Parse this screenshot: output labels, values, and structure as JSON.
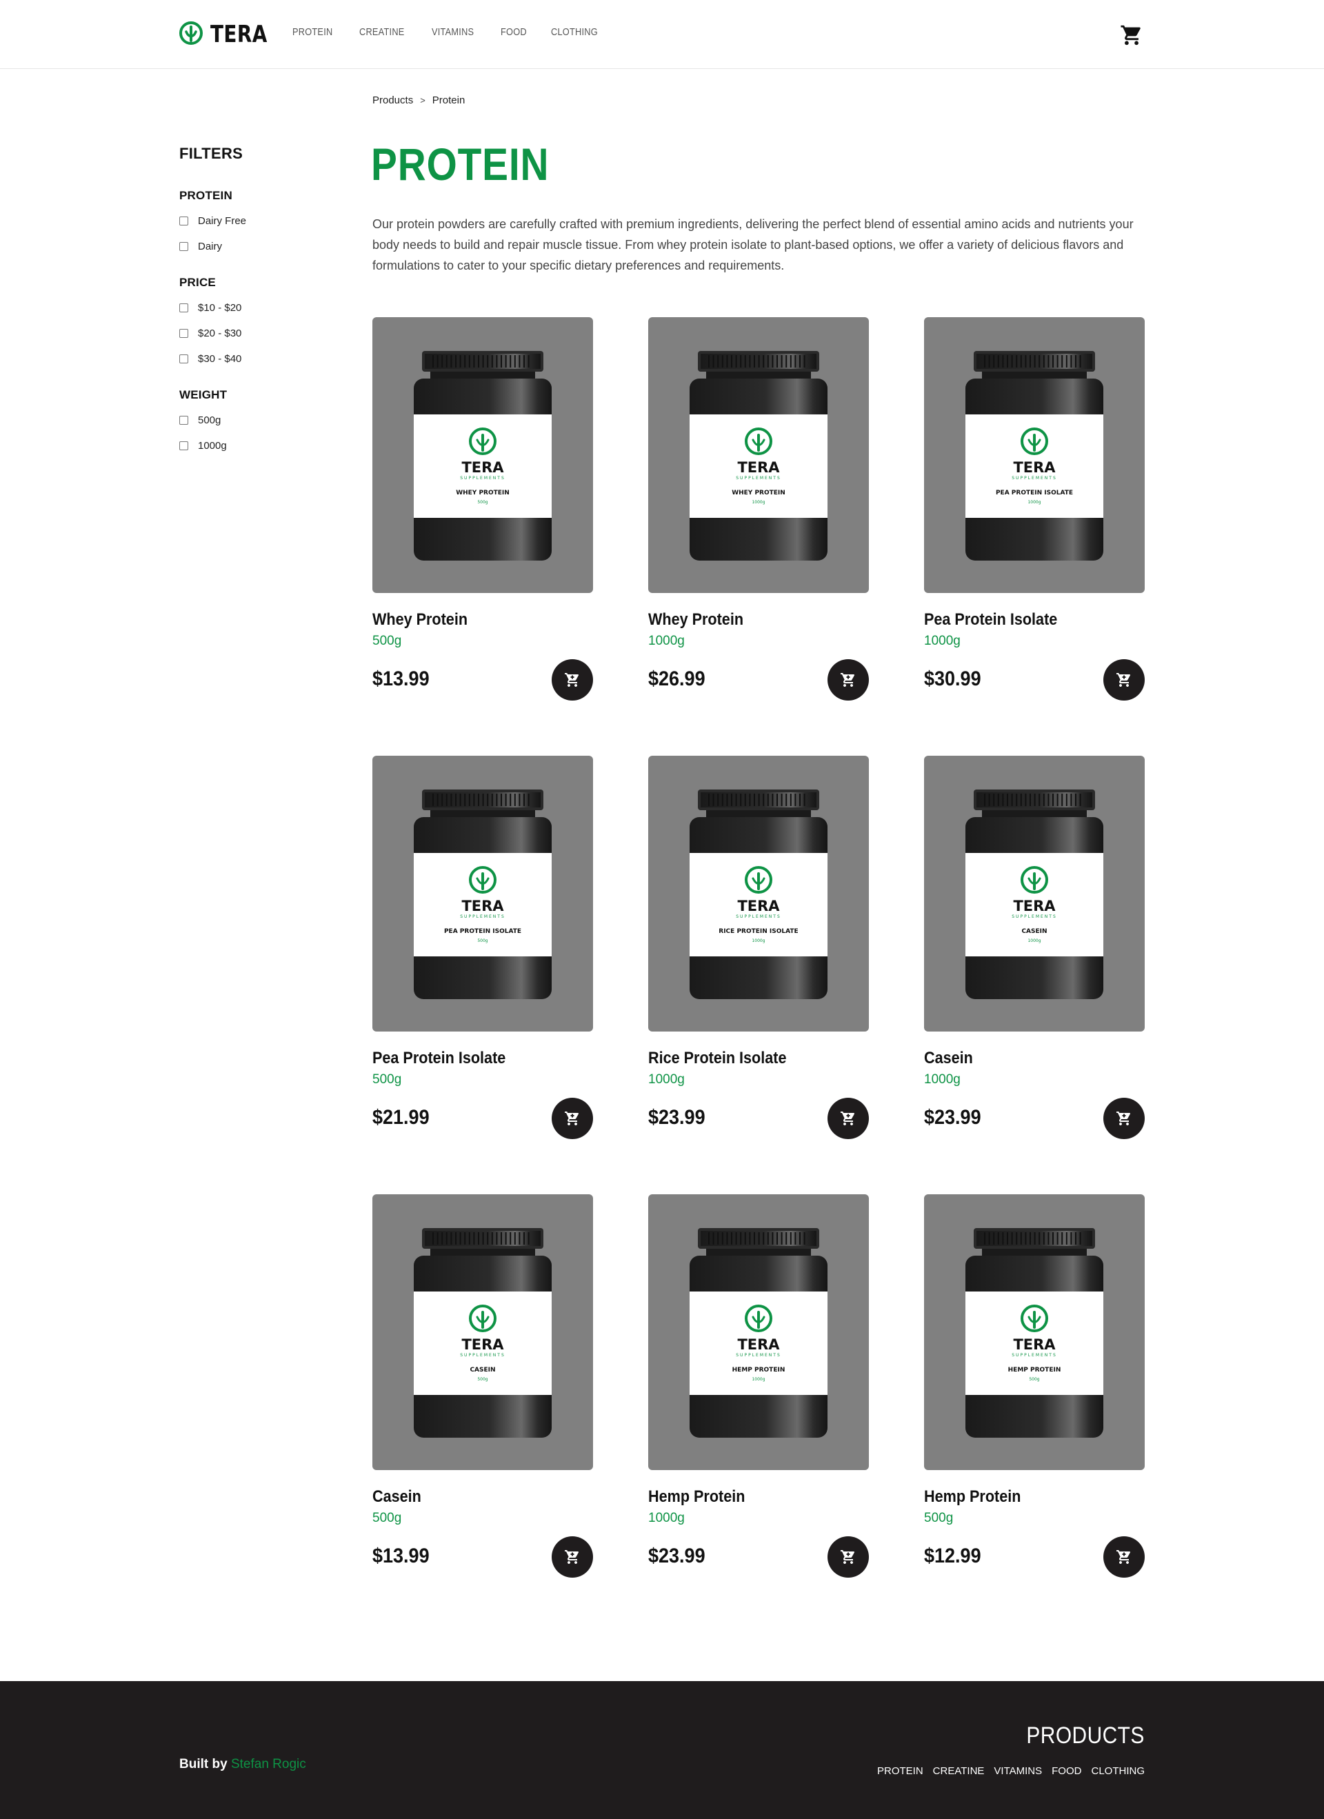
{
  "brand": {
    "name": "TERA",
    "accent_color": "#0e9345",
    "dark_color": "#1f1c1d"
  },
  "nav": {
    "items": [
      "PROTEIN",
      "CREATINE",
      "VITAMINS",
      "FOOD",
      "CLOTHING"
    ]
  },
  "breadcrumb": {
    "items": [
      "Products",
      "Protein"
    ],
    "separator": ">"
  },
  "sidebar": {
    "title": "FILTERS",
    "groups": [
      {
        "title": "PROTEIN",
        "options": [
          "Dairy Free",
          "Dairy"
        ]
      },
      {
        "title": "PRICE",
        "options": [
          "$10 - $20",
          "$20 - $30",
          "$30 - $40"
        ]
      },
      {
        "title": "WEIGHT",
        "options": [
          "500g",
          "1000g"
        ]
      }
    ]
  },
  "main": {
    "title": "PROTEIN",
    "description": "Our protein powders are carefully crafted with premium ingredients, delivering the perfect blend of essential amino acids and nutrients your body needs to build and repair muscle tissue. From whey protein isolate to plant-based options, we offer a variety of delicious flavors and formulations to cater to your specific dietary preferences and requirements."
  },
  "products": [
    {
      "name": "Whey Protein",
      "weight": "500g",
      "price": "$13.99",
      "label_brand": "TERA",
      "label_sub": "SUPPLEMENTS",
      "label_product": "WHEY PROTEIN",
      "label_weight": "500g"
    },
    {
      "name": "Whey Protein",
      "weight": "1000g",
      "price": "$26.99",
      "label_brand": "TERA",
      "label_sub": "SUPPLEMENTS",
      "label_product": "WHEY PROTEIN",
      "label_weight": "1000g"
    },
    {
      "name": "Pea Protein Isolate",
      "weight": "1000g",
      "price": "$30.99",
      "label_brand": "TERA",
      "label_sub": "SUPPLEMENTS",
      "label_product": "PEA PROTEIN ISOLATE",
      "label_weight": "1000g"
    },
    {
      "name": "Pea Protein Isolate",
      "weight": "500g",
      "price": "$21.99",
      "label_brand": "TERA",
      "label_sub": "SUPPLEMENTS",
      "label_product": "PEA PROTEIN ISOLATE",
      "label_weight": "500g"
    },
    {
      "name": "Rice Protein Isolate",
      "weight": "1000g",
      "price": "$23.99",
      "label_brand": "TERA",
      "label_sub": "SUPPLEMENTS",
      "label_product": "RICE PROTEIN ISOLATE",
      "label_weight": "1000g"
    },
    {
      "name": "Casein",
      "weight": "1000g",
      "price": "$23.99",
      "label_brand": "TERA",
      "label_sub": "SUPPLEMENTS",
      "label_product": "CASEIN",
      "label_weight": "1000g"
    },
    {
      "name": "Casein",
      "weight": "500g",
      "price": "$13.99",
      "label_brand": "TERA",
      "label_sub": "SUPPLEMENTS",
      "label_product": "CASEIN",
      "label_weight": "500g"
    },
    {
      "name": "Hemp Protein",
      "weight": "1000g",
      "price": "$23.99",
      "label_brand": "TERA",
      "label_sub": "SUPPLEMENTS",
      "label_product": "HEMP PROTEIN",
      "label_weight": "1000g"
    },
    {
      "name": "Hemp Protein",
      "weight": "500g",
      "price": "$12.99",
      "label_brand": "TERA",
      "label_sub": "SUPPLEMENTS",
      "label_product": "HEMP PROTEIN",
      "label_weight": "500g"
    }
  ],
  "icons": {
    "cart": "cart-icon",
    "add_to_cart": "add-to-cart-icon",
    "logo": "leaf-logo-icon"
  },
  "footer": {
    "built_by_label": "Built by",
    "built_by_name": "Stefan Rogic",
    "products_title": "PRODUCTS",
    "links": [
      "PROTEIN",
      "CREATINE",
      "VITAMINS",
      "FOOD",
      "CLOTHING"
    ]
  }
}
